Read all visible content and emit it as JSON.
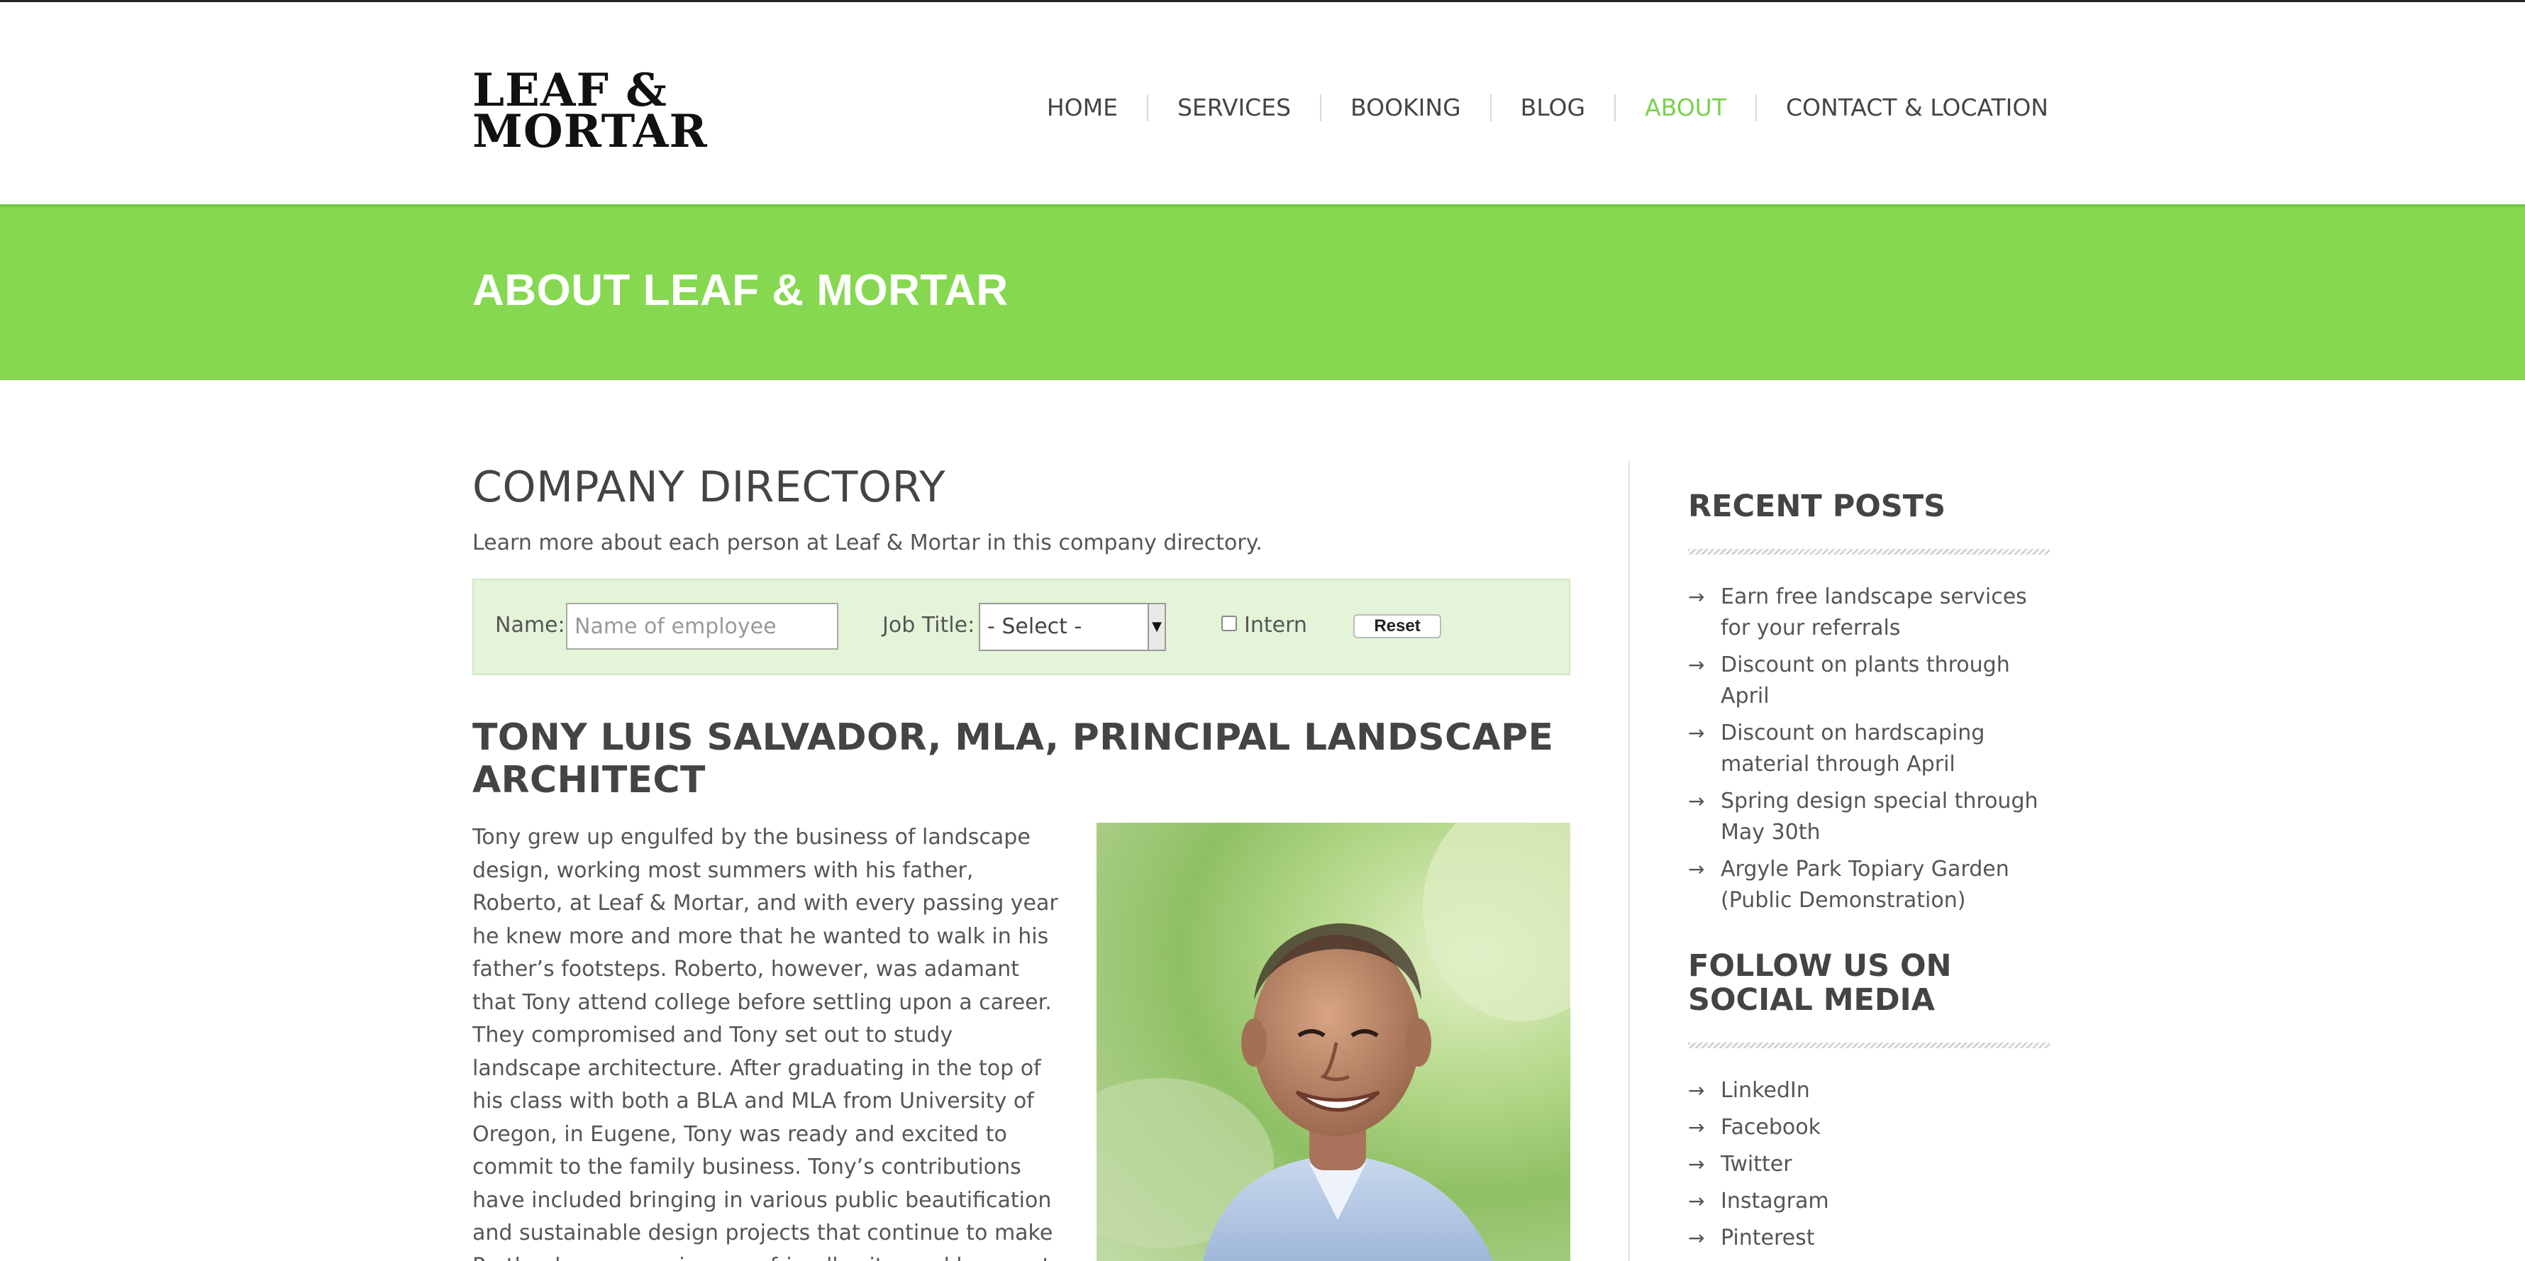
{
  "logo": {
    "line1": "LEAF &",
    "line2": "MORTAR"
  },
  "nav": {
    "items": [
      {
        "label": "HOME",
        "active": false
      },
      {
        "label": "SERVICES",
        "active": false
      },
      {
        "label": "BOOKING",
        "active": false
      },
      {
        "label": "BLOG",
        "active": false
      },
      {
        "label": "ABOUT",
        "active": true
      },
      {
        "label": "CONTACT & LOCATION",
        "active": false
      }
    ],
    "active_color": "#7ad14a"
  },
  "banner": {
    "title": "ABOUT LEAF & MORTAR",
    "color": "#86d851"
  },
  "main": {
    "heading": "COMPANY DIRECTORY",
    "intro": "Learn more about each person at Leaf & Mortar in this company directory.",
    "filter": {
      "name_label": "Name:",
      "name_placeholder": "Name of employee",
      "job_label": "Job Title:",
      "job_selected": "- Select -",
      "intern_label": "Intern",
      "intern_checked": false,
      "reset_label": "Reset"
    },
    "person": {
      "heading": "TONY LUIS SALVADOR, MLA, PRINCIPAL LANDSCAPE ARCHITECT",
      "bio": "Tony grew up engulfed by the business of landscape design, working most summers with his father, Roberto, at Leaf & Mortar, and with every passing year he knew more and more that he wanted to walk in his father’s footsteps. Roberto, however, was adamant that Tony attend college before settling upon a career. They compromised and Tony set out to study landscape architecture. After graduating in the top of his class with both a BLA and MLA from University of Oregon, in Eugene, Tony was ready and excited to commit to the family business. Tony’s contributions have included bringing in various public beautification and sustainable design projects that continue to make Portland a progressive, eco-friendly city, and have put Leaf & Mortar on"
    }
  },
  "sidebar": {
    "recent_heading": "RECENT POSTS",
    "recent_posts": [
      "Earn free landscape services for your referrals",
      "Discount on plants through April",
      "Discount on hardscaping material through April",
      "Spring design special through May 30th",
      "Argyle Park Topiary Garden (Public Demonstration)"
    ],
    "social_heading": "FOLLOW US ON SOCIAL MEDIA",
    "social_links": [
      "LinkedIn",
      "Facebook",
      "Twitter",
      "Instagram",
      "Pinterest"
    ],
    "bullet": "→"
  }
}
